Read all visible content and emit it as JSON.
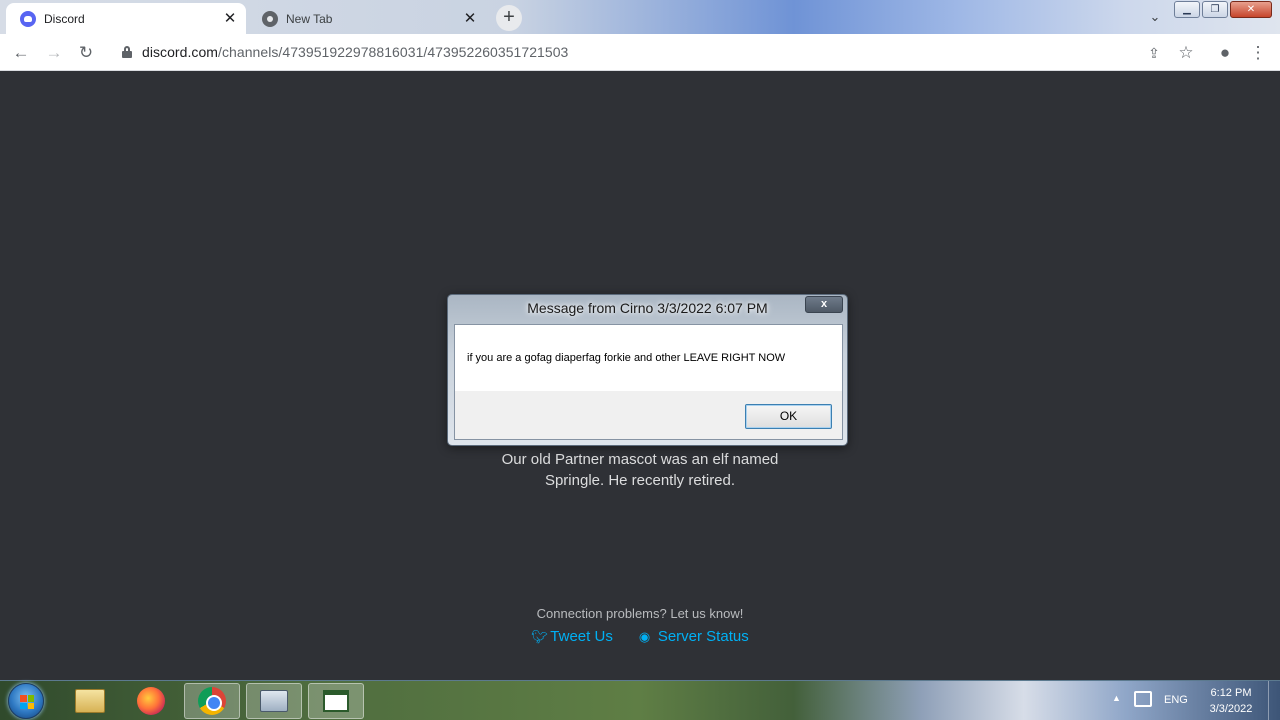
{
  "browser": {
    "tabs": [
      {
        "title": "Discord",
        "active": true
      },
      {
        "title": "New Tab",
        "active": false
      }
    ],
    "url_domain": "discord.com",
    "url_path": "/channels/473951922978816031/473952260351721503"
  },
  "page": {
    "tip_line1": "Our old Partner mascot was an elf named",
    "tip_line2": "Springle. He recently retired.",
    "connection_text": "Connection problems? Let us know!",
    "tweet_label": "Tweet Us",
    "status_label": "Server Status",
    "link_color": "#00b0f4",
    "background_color": "#2f3136"
  },
  "dialog": {
    "title": "Message from Cirno 3/3/2022 6:07 PM",
    "close_label": "x",
    "message": "if you are a gofag diaperfag forkie and other LEAVE RIGHT NOW",
    "ok_label": "OK"
  },
  "taskbar": {
    "apps": [
      "windows-explorer",
      "firefox",
      "chrome",
      "system-monitor",
      "notepad"
    ],
    "language": "ENG",
    "time": "6:12 PM",
    "date": "3/3/2022"
  }
}
